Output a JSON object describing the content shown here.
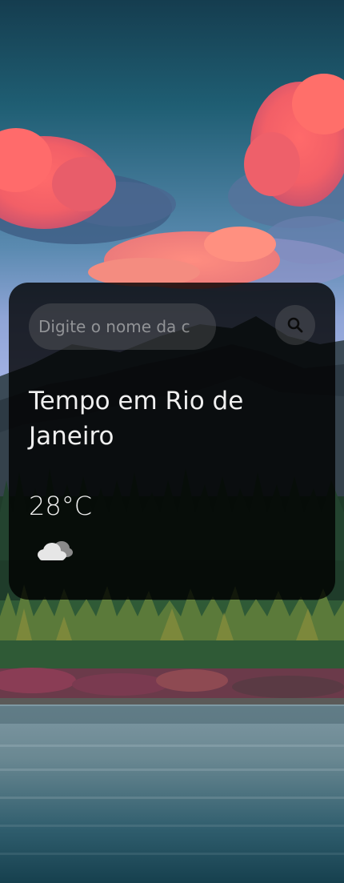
{
  "search": {
    "placeholder": "Digite o nome da c",
    "value": ""
  },
  "weather": {
    "city_heading": "Tempo em Rio de Janeiro",
    "temperature": "28°C",
    "icon": "cloudy-icon"
  },
  "colors": {
    "card_background": "#000000",
    "text": "#f0f0f0",
    "pill": "#7d7d7d"
  }
}
